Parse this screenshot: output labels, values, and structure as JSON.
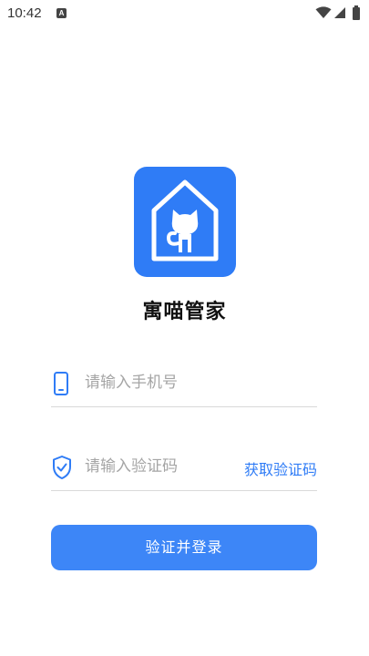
{
  "status_bar": {
    "time": "10:42",
    "notification_icon_letter": "A",
    "icons": [
      "wifi-icon",
      "cellular-signal-icon",
      "battery-icon"
    ]
  },
  "app": {
    "name": "寓喵管家",
    "logo_icon": "house-cat-logo-icon",
    "brand_color": "#2f7cf6"
  },
  "form": {
    "phone": {
      "icon": "phone-icon",
      "value": "",
      "placeholder": "请输入手机号"
    },
    "code": {
      "icon": "shield-check-icon",
      "value": "",
      "placeholder": "请输入验证码",
      "get_code_label": "获取验证码"
    },
    "submit_label": "验证并登录",
    "button_color": "#3d86f7"
  }
}
